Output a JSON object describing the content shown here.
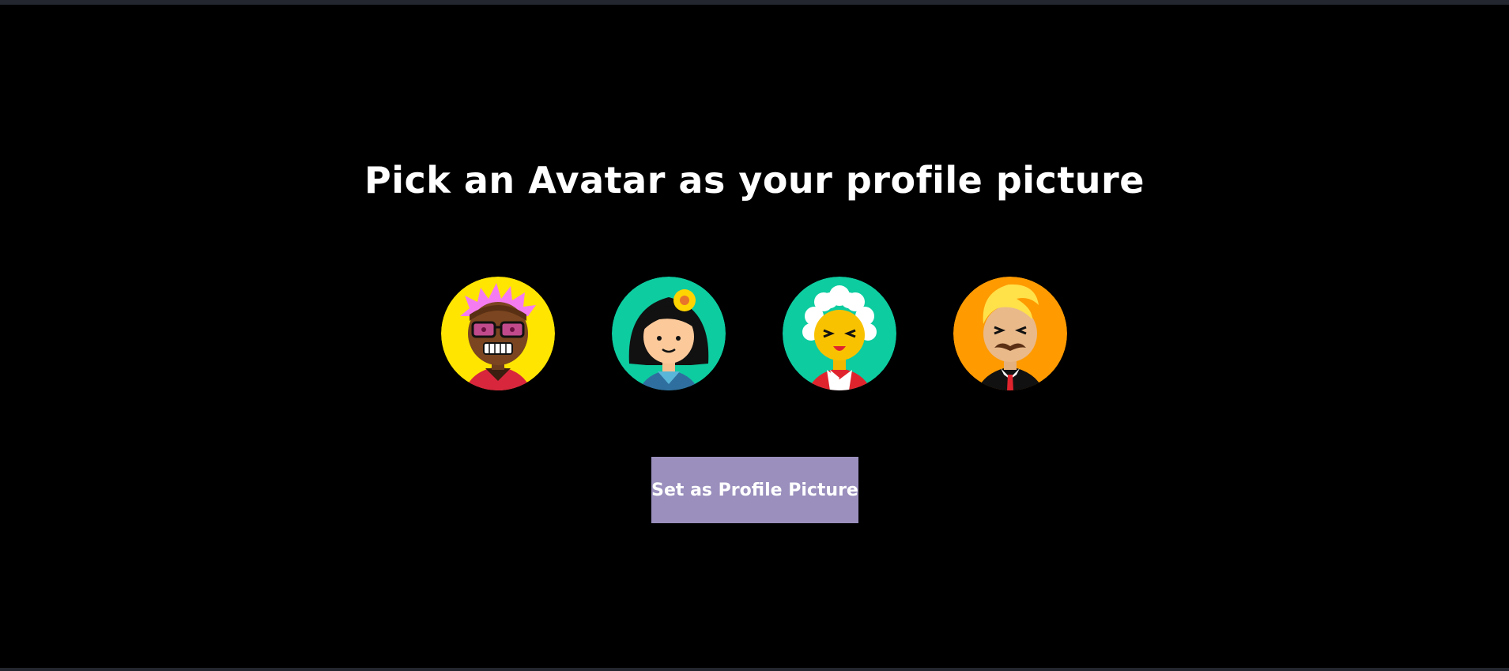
{
  "title": "Pick an Avatar as your profile picture",
  "avatars": [
    {
      "id": "avatar-1",
      "description": "man with pink spiky hair and glasses",
      "bg": "#ffe500"
    },
    {
      "id": "avatar-2",
      "description": "woman with black hair and flower",
      "bg": "#0dcca0"
    },
    {
      "id": "avatar-3",
      "description": "elderly woman with white curly hair",
      "bg": "#0dcca0"
    },
    {
      "id": "avatar-4",
      "description": "man with blonde hair and mustache",
      "bg": "#ff9a00"
    }
  ],
  "submit_label": "Set as Profile Picture",
  "colors": {
    "background": "#000000",
    "button": "#9a8fbd",
    "text": "#ffffff"
  }
}
